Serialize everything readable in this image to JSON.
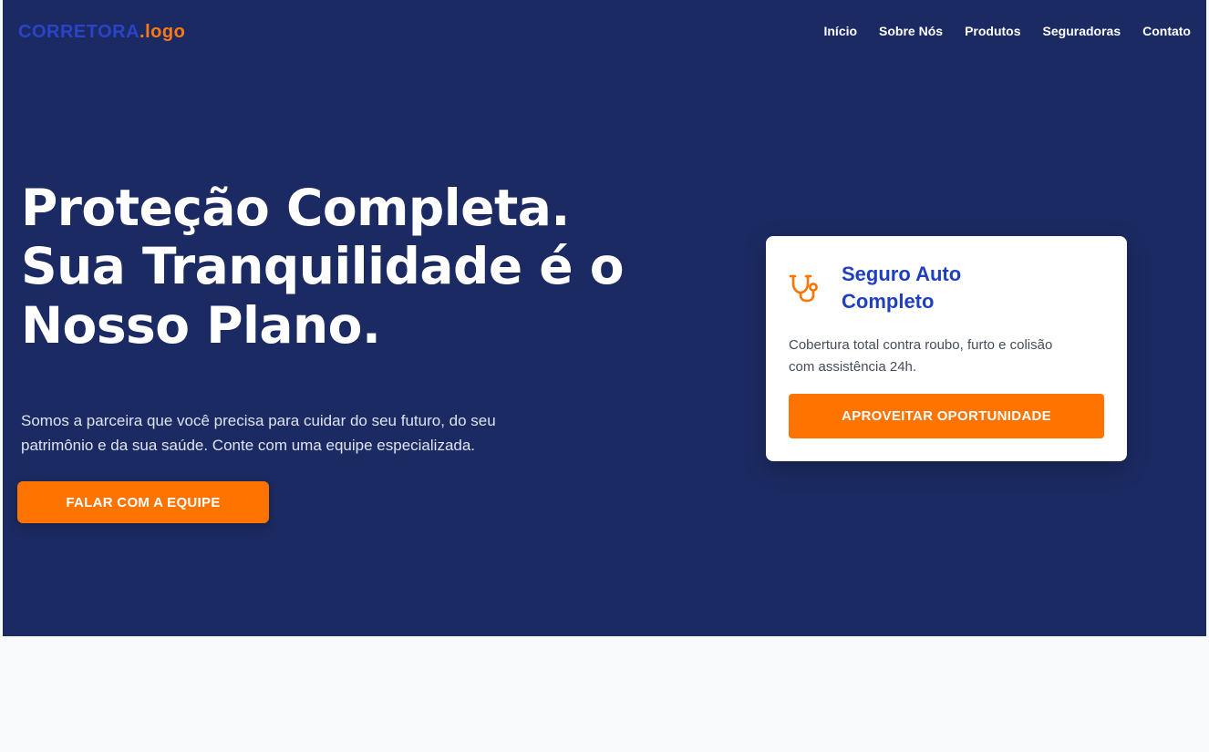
{
  "navbar": {
    "logo_main": "CORRETORA",
    "logo_accent": ".logo",
    "links": [
      {
        "label": "Início"
      },
      {
        "label": "Sobre Nós"
      },
      {
        "label": "Produtos"
      },
      {
        "label": "Seguradoras"
      },
      {
        "label": "Contato"
      }
    ]
  },
  "hero": {
    "headline_line1": "Proteção Completa.",
    "headline_line2": "Sua Tranquilidade é o",
    "headline_line3": "Nosso Plano.",
    "subtext_line1": "Somos a parceira que você precisa para cuidar do seu futuro, do seu",
    "subtext_line2": "patrimônio e da sua saúde. Conte com uma equipe especializada.",
    "cta_label": "FALAR COM A EQUIPE"
  },
  "card": {
    "icon": "stethoscope-icon",
    "title_line1": "Seguro Auto",
    "title_line2": "Completo",
    "desc_line1": "Cobertura total contra roubo, furto e colisão",
    "desc_line2": "com assistência 24h.",
    "cta_label": "APROVEITAR OPORTUNIDADE"
  },
  "colors": {
    "hero_bg": "#1b2a62",
    "accent": "#ff7300",
    "card_title": "#1f3fbf",
    "logo_main": "#2a43c8"
  }
}
